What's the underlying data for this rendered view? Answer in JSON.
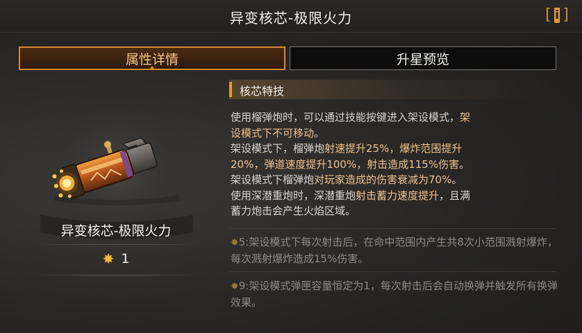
{
  "header": {
    "title": "异变核芯-极限火力",
    "info_label": "i"
  },
  "tabs": [
    {
      "label": "属性详情",
      "active": true
    },
    {
      "label": "升星预览",
      "active": false
    }
  ],
  "item": {
    "name": "异变核芯-极限火力",
    "star_icon": "star-icon",
    "star_value": "1"
  },
  "section": {
    "title": "核芯特技"
  },
  "description": {
    "l1_a": "使用榴弹炮时，可以通过技能按键进入架设模式，",
    "l1_b": "架",
    "l2_a": "设模式下不可移动",
    "l2_b": "。",
    "l3": "架设模式下，榴弹炮",
    "l3_hl": "射速提升25%，爆炸范围提升",
    "l4_hl": "20%，弹道速度提升100%，射击造成115%伤害",
    "l4_end": "。",
    "l5_a": "架设模式下榴弹炮",
    "l5_hl": "对玩家造成的伤害衰减为70%",
    "l5_end": "。",
    "l6_a": "使用深潜重炮时，深潜重炮",
    "l6_hl": "射击蓄力速度提升",
    "l6_b": "，且满",
    "l7": "蓄力炮击会产生火焰区域。"
  },
  "upgrades": [
    {
      "prefix": "5:",
      "text": "架设模式下每次射击后，在命中范围内产生共8次小范围溅射爆炸，每次溅射爆炸造成15%伤害。"
    },
    {
      "prefix": "9:",
      "text": "架设模式弹匣容量恒定为1，每次射击后会自动换弹并触发所有换弹效果。"
    }
  ],
  "colors": {
    "accent": "#d98a2e",
    "highlight": "#f0c08a",
    "star": "#f2b830"
  }
}
